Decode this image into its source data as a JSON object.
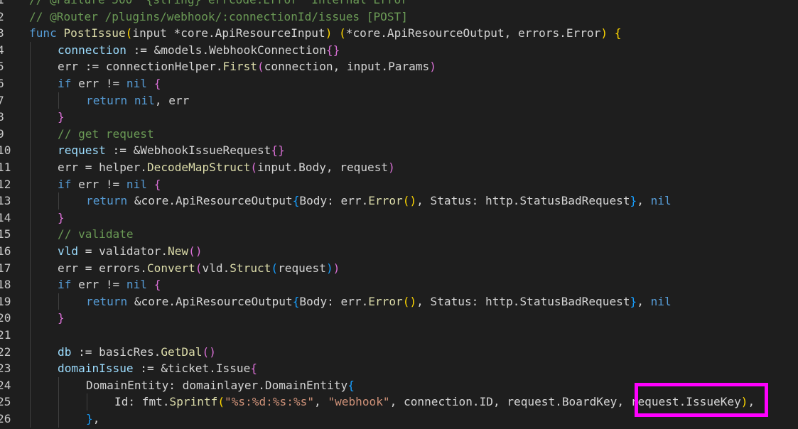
{
  "editor": {
    "colors": {
      "background": "#1e1e1e",
      "highlight_box": "#ff00ff"
    },
    "lines": [
      {
        "num": "1",
        "indent": 0,
        "tokens": [
          {
            "t": "// @Failure 500  {string} errcode.Error \"Internal Error\"",
            "c": "cm"
          }
        ]
      },
      {
        "num": "2",
        "indent": 0,
        "tokens": [
          {
            "t": "// @Router /plugins/webhook/:connectionId/issues [POST]",
            "c": "cm"
          }
        ]
      },
      {
        "num": "3",
        "indent": 0,
        "tokens": [
          {
            "t": "func ",
            "c": "kw"
          },
          {
            "t": "PostIssue",
            "c": "fn"
          },
          {
            "t": "(",
            "c": "b1"
          },
          {
            "t": "input *core.ApiResourceInput",
            "c": "pl"
          },
          {
            "t": ")",
            "c": "b1"
          },
          {
            "t": " ",
            "c": "pl"
          },
          {
            "t": "(",
            "c": "b1"
          },
          {
            "t": "*core.ApiResourceOutput, errors.Error",
            "c": "pl"
          },
          {
            "t": ")",
            "c": "b1"
          },
          {
            "t": " ",
            "c": "pl"
          },
          {
            "t": "{",
            "c": "b1"
          }
        ]
      },
      {
        "num": "4",
        "indent": 1,
        "tokens": [
          {
            "t": "connection",
            "c": "vr"
          },
          {
            "t": " := &models.WebhookConnection",
            "c": "pl"
          },
          {
            "t": "{}",
            "c": "b2"
          }
        ]
      },
      {
        "num": "5",
        "indent": 1,
        "tokens": [
          {
            "t": "err := connectionHelper.",
            "c": "pl"
          },
          {
            "t": "First",
            "c": "fn"
          },
          {
            "t": "(",
            "c": "b2"
          },
          {
            "t": "connection, input.Params",
            "c": "pl"
          },
          {
            "t": ")",
            "c": "b2"
          }
        ]
      },
      {
        "num": "6",
        "indent": 1,
        "tokens": [
          {
            "t": "if",
            "c": "kw"
          },
          {
            "t": " err != ",
            "c": "pl"
          },
          {
            "t": "nil",
            "c": "kw"
          },
          {
            "t": " ",
            "c": "pl"
          },
          {
            "t": "{",
            "c": "b2"
          }
        ]
      },
      {
        "num": "7",
        "indent": 2,
        "tokens": [
          {
            "t": "return",
            "c": "kw"
          },
          {
            "t": " ",
            "c": "pl"
          },
          {
            "t": "nil",
            "c": "kw"
          },
          {
            "t": ", err",
            "c": "pl"
          }
        ]
      },
      {
        "num": "8",
        "indent": 1,
        "tokens": [
          {
            "t": "}",
            "c": "b2"
          }
        ]
      },
      {
        "num": "9",
        "indent": 1,
        "tokens": [
          {
            "t": "// get request",
            "c": "cm"
          }
        ]
      },
      {
        "num": "10",
        "indent": 1,
        "tokens": [
          {
            "t": "request",
            "c": "vr"
          },
          {
            "t": " := &WebhookIssueRequest",
            "c": "pl"
          },
          {
            "t": "{}",
            "c": "b2"
          }
        ]
      },
      {
        "num": "11",
        "indent": 1,
        "tokens": [
          {
            "t": "err = helper.",
            "c": "pl"
          },
          {
            "t": "DecodeMapStruct",
            "c": "fn"
          },
          {
            "t": "(",
            "c": "b2"
          },
          {
            "t": "input.Body, request",
            "c": "pl"
          },
          {
            "t": ")",
            "c": "b2"
          }
        ]
      },
      {
        "num": "12",
        "indent": 1,
        "tokens": [
          {
            "t": "if",
            "c": "kw"
          },
          {
            "t": " err != ",
            "c": "pl"
          },
          {
            "t": "nil",
            "c": "kw"
          },
          {
            "t": " ",
            "c": "pl"
          },
          {
            "t": "{",
            "c": "b2"
          }
        ]
      },
      {
        "num": "13",
        "indent": 2,
        "tokens": [
          {
            "t": "return",
            "c": "kw"
          },
          {
            "t": " &core.ApiResourceOutput",
            "c": "pl"
          },
          {
            "t": "{",
            "c": "b3"
          },
          {
            "t": "Body: err.",
            "c": "pl"
          },
          {
            "t": "Error",
            "c": "fn"
          },
          {
            "t": "()",
            "c": "b1"
          },
          {
            "t": ", Status: http.StatusBadRequest",
            "c": "pl"
          },
          {
            "t": "}",
            "c": "b3"
          },
          {
            "t": ", ",
            "c": "pl"
          },
          {
            "t": "nil",
            "c": "kw"
          }
        ]
      },
      {
        "num": "14",
        "indent": 1,
        "tokens": [
          {
            "t": "}",
            "c": "b2"
          }
        ]
      },
      {
        "num": "15",
        "indent": 1,
        "tokens": [
          {
            "t": "// validate",
            "c": "cm"
          }
        ]
      },
      {
        "num": "16",
        "indent": 1,
        "tokens": [
          {
            "t": "vld",
            "c": "vr"
          },
          {
            "t": " = validator.",
            "c": "pl"
          },
          {
            "t": "New",
            "c": "fn"
          },
          {
            "t": "()",
            "c": "b2"
          }
        ]
      },
      {
        "num": "17",
        "indent": 1,
        "tokens": [
          {
            "t": "err = errors.",
            "c": "pl"
          },
          {
            "t": "Convert",
            "c": "fn"
          },
          {
            "t": "(",
            "c": "b2"
          },
          {
            "t": "vld.",
            "c": "pl"
          },
          {
            "t": "Struct",
            "c": "fn"
          },
          {
            "t": "(",
            "c": "b3"
          },
          {
            "t": "request",
            "c": "pl"
          },
          {
            "t": ")",
            "c": "b3"
          },
          {
            "t": ")",
            "c": "b2"
          }
        ]
      },
      {
        "num": "18",
        "indent": 1,
        "tokens": [
          {
            "t": "if",
            "c": "kw"
          },
          {
            "t": " err != ",
            "c": "pl"
          },
          {
            "t": "nil",
            "c": "kw"
          },
          {
            "t": " ",
            "c": "pl"
          },
          {
            "t": "{",
            "c": "b2"
          }
        ]
      },
      {
        "num": "19",
        "indent": 2,
        "tokens": [
          {
            "t": "return",
            "c": "kw"
          },
          {
            "t": " &core.ApiResourceOutput",
            "c": "pl"
          },
          {
            "t": "{",
            "c": "b3"
          },
          {
            "t": "Body: err.",
            "c": "pl"
          },
          {
            "t": "Error",
            "c": "fn"
          },
          {
            "t": "()",
            "c": "b1"
          },
          {
            "t": ", Status: http.StatusBadRequest",
            "c": "pl"
          },
          {
            "t": "}",
            "c": "b3"
          },
          {
            "t": ", ",
            "c": "pl"
          },
          {
            "t": "nil",
            "c": "kw"
          }
        ]
      },
      {
        "num": "20",
        "indent": 1,
        "tokens": [
          {
            "t": "}",
            "c": "b2"
          }
        ]
      },
      {
        "num": "21",
        "indent": 1,
        "tokens": []
      },
      {
        "num": "22",
        "indent": 1,
        "tokens": [
          {
            "t": "db",
            "c": "vr"
          },
          {
            "t": " := basicRes.",
            "c": "pl"
          },
          {
            "t": "GetDal",
            "c": "fn"
          },
          {
            "t": "()",
            "c": "b2"
          }
        ]
      },
      {
        "num": "23",
        "indent": 1,
        "tokens": [
          {
            "t": "domainIssue",
            "c": "vr"
          },
          {
            "t": " := &ticket.Issue",
            "c": "pl"
          },
          {
            "t": "{",
            "c": "b2"
          }
        ]
      },
      {
        "num": "24",
        "indent": 2,
        "tokens": [
          {
            "t": "DomainEntity: domainlayer.DomainEntity",
            "c": "pl"
          },
          {
            "t": "{",
            "c": "b3"
          }
        ]
      },
      {
        "num": "25",
        "indent": 3,
        "tokens": [
          {
            "t": "Id: fmt.",
            "c": "pl"
          },
          {
            "t": "Sprintf",
            "c": "fn"
          },
          {
            "t": "(",
            "c": "b1"
          },
          {
            "t": "\"%s:%d:%s:%s\"",
            "c": "st"
          },
          {
            "t": ", ",
            "c": "pl"
          },
          {
            "t": "\"webhook\"",
            "c": "st"
          },
          {
            "t": ", connection.ID, request.BoardKey, request.IssueKey",
            "c": "pl"
          },
          {
            "t": ")",
            "c": "b1"
          },
          {
            "t": ",",
            "c": "pl"
          }
        ]
      },
      {
        "num": "26",
        "indent": 2,
        "tokens": [
          {
            "t": "}",
            "c": "b3"
          },
          {
            "t": ",",
            "c": "pl"
          }
        ]
      }
    ]
  }
}
